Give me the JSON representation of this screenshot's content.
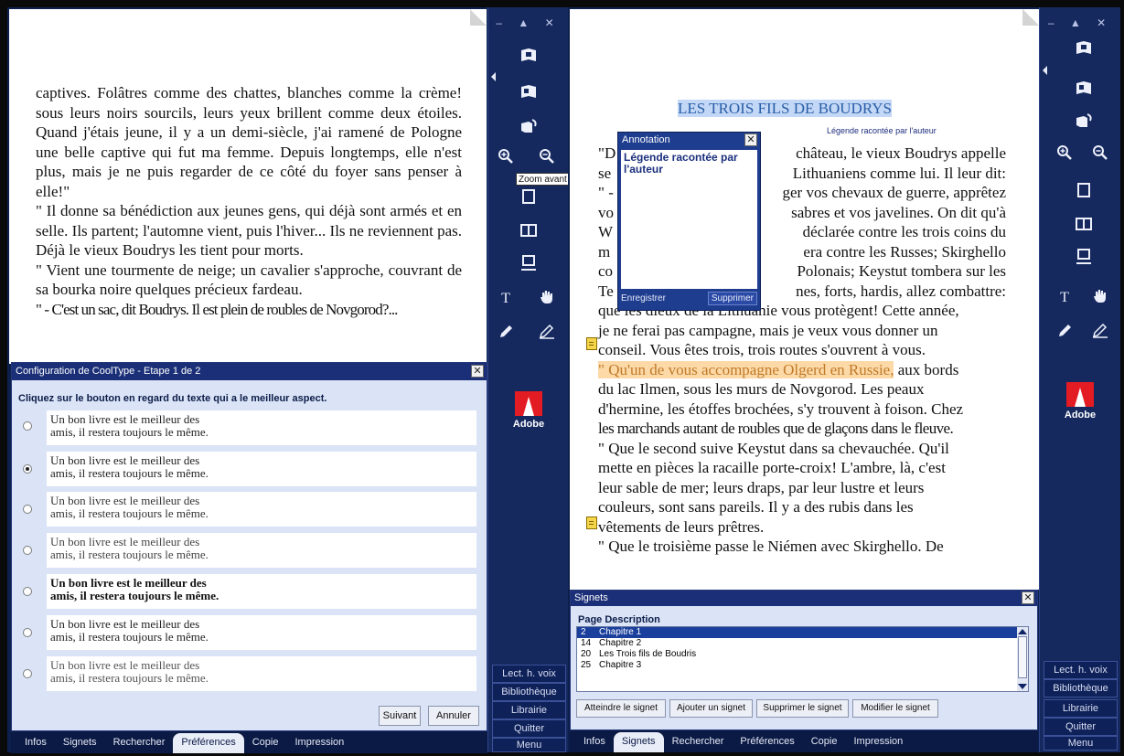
{
  "left": {
    "book_lines": [
      "captives. Folâtres comme des chattes, blanches comme la crème! sous leurs noirs sourcils, leurs yeux brillent comme deux étoiles. Quand j'étais jeune, il y a un demi-siècle, j'ai ramené de Pologne une belle captive qui fut ma femme. Depuis longtemps, elle n'est plus, mais je ne puis regarder de ce côté du foyer sans penser à elle!\"",
      "\" Il donne sa bénédiction aux jeunes gens, qui déjà sont armés et en selle. Ils partent; l'automne vient, puis l'hiver... Ils ne reviennent pas. Déjà le vieux Boudrys les tient pour morts.",
      "\" Vient une tourmente de neige; un cavalier s'approche, couvrant de sa bourka noire quelques précieux fardeau.",
      "\" - C'est un sac, dit Boudrys. Il est plein de roubles de Novgorod?..."
    ],
    "cooltype": {
      "title": "Configuration de CoolType - Etape 1 de 2",
      "close": "✕",
      "instruction": "Cliquez sur le bouton en regard du texte qui a le meilleur aspect.",
      "samples": [
        {
          "line1": "Un bon livre est le meilleur des",
          "line2": "amis, il restera toujours le même."
        },
        {
          "line1": "Un bon livre est le meilleur des",
          "line2": "amis, il restera toujours le même."
        },
        {
          "line1": "Un bon livre est le meilleur des",
          "line2": "amis, il restera toujours le même."
        },
        {
          "line1": "Un bon livre est le meilleur des",
          "line2": "amis, il restera toujours le même."
        },
        {
          "line1": "Un bon livre est le meilleur des",
          "line2": "amis, il restera toujours le même."
        },
        {
          "line1": "Un bon livre est le meilleur des",
          "line2": "amis, il restera toujours le même."
        },
        {
          "line1": "Un bon livre est le meilleur des",
          "line2": "amis, il restera toujours le même."
        }
      ],
      "selected_index": 1,
      "next": "Suivant",
      "cancel": "Annuler"
    },
    "tabs": [
      "Infos",
      "Signets",
      "Rechercher",
      "Préférences",
      "Copie",
      "Impression"
    ],
    "active_tab": "Préférences"
  },
  "right": {
    "story_title": "LES TROIS FILS DE BOUDRYS",
    "story_subtitle": "Légende racontée par l'auteur",
    "col_lines": [
      "\"D",
      "se",
      "\" -",
      "vo",
      "W",
      "m",
      "co",
      "Te"
    ],
    "right_lines": [
      "château, le vieux Boudrys appelle",
      "Lithuaniens comme lui. Il leur dit:",
      "ger vos chevaux de guerre, apprêtez",
      "sabres et vos javelines. On dit qu'à",
      "déclarée contre les trois coins du",
      "era contre les Russes; Skirghello",
      "Polonais; Keystut tombera sur les",
      "nes, forts, hardis, allez combattre:"
    ],
    "body_lines": [
      "que les dieux de la Lithuanie vous protègent! Cette année,",
      "je ne ferai pas campagne, mais je veux vous donner un",
      "conseil. Vous êtes trois, trois routes s'ouvrent à vous."
    ],
    "highlight_quote": "\" Qu'un de vous accompagne Olgerd en Russie,",
    "after_highlight": "aux bords",
    "body_lines_2": [
      "du lac Ilmen, sous les murs de Novgorod. Les peaux",
      "d'hermine, les étoffes brochées, s'y trouvent à foison. Chez",
      "les marchands autant de roubles que de glaçons dans le fleuve.",
      "\" Que le second suive Keystut dans sa chevauchée. Qu'il",
      "mette en pièces la racaille porte-croix! L'ambre, là, c'est",
      "leur sable de mer; leurs draps, par leur lustre et leurs",
      "couleurs, sont sans pareils. Il y a des rubis dans les",
      "vêtements de leurs prêtres.",
      "\" Que le troisième passe le Niémen avec Skirghello. De"
    ],
    "annotation": {
      "title": "Annotation",
      "close": "✕",
      "text": "Légende racontée par l'auteur",
      "save": "Enregistrer",
      "delete": "Supprimer"
    },
    "bookmarks": {
      "title": "Signets",
      "close": "✕",
      "header": "Page Description",
      "rows": [
        {
          "page": "2",
          "desc": "Chapitre 1"
        },
        {
          "page": "14",
          "desc": "Chapitre 2"
        },
        {
          "page": "20",
          "desc": "Les Trois fils de Boudris"
        },
        {
          "page": "25",
          "desc": "Chapitre 3"
        }
      ],
      "selected_index": 0,
      "buttons": [
        "Atteindre le signet",
        "Ajouter un signet",
        "Supprimer le signet",
        "Modifier le signet"
      ]
    },
    "tabs": [
      "Infos",
      "Signets",
      "Rechercher",
      "Préférences",
      "Copie",
      "Impression"
    ],
    "active_tab": "Signets"
  },
  "sidebar": {
    "window_controls": "– ▲ ✕",
    "tooltip": "Zoom avant",
    "brand": "Adobe",
    "buttons": [
      "Lect. h. voix",
      "Bibliothèque",
      "Librairie",
      "Quitter",
      "Menu"
    ]
  },
  "colors": {
    "navy": "#0d1f4d",
    "highlight_blue": "#c3d7f6",
    "highlight_orange": "#fcd9a6",
    "adobe_red": "#e31b23"
  }
}
